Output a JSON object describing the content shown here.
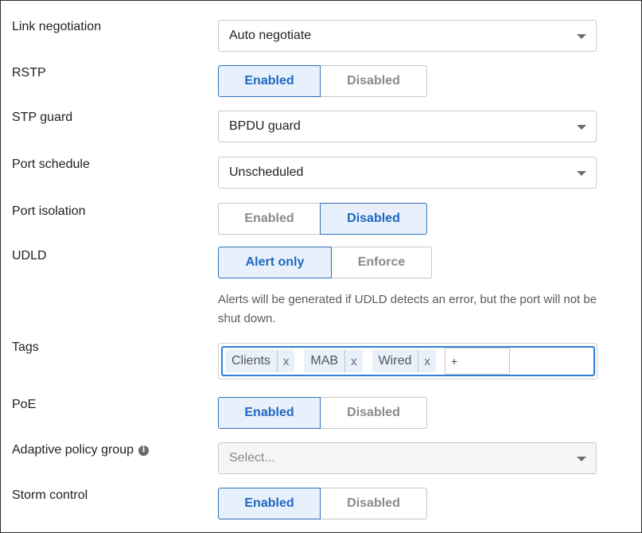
{
  "link_negotiation": {
    "label": "Link negotiation",
    "value": "Auto negotiate"
  },
  "rstp": {
    "label": "RSTP",
    "options": [
      "Enabled",
      "Disabled"
    ],
    "selected": "Enabled"
  },
  "stp_guard": {
    "label": "STP guard",
    "value": "BPDU guard"
  },
  "port_schedule": {
    "label": "Port schedule",
    "value": "Unscheduled"
  },
  "port_isolation": {
    "label": "Port isolation",
    "options": [
      "Enabled",
      "Disabled"
    ],
    "selected": "Disabled"
  },
  "udld": {
    "label": "UDLD",
    "options": [
      "Alert only",
      "Enforce"
    ],
    "selected": "Alert only",
    "helper_line1": "Alerts will be generated if UDLD detects an error, but the port will not be",
    "helper_line2": "shut down."
  },
  "tags": {
    "label": "Tags",
    "items": [
      "Clients",
      "MAB",
      "Wired"
    ],
    "remove_glyph": "x",
    "add_placeholder": "+"
  },
  "poe": {
    "label": "PoE",
    "options": [
      "Enabled",
      "Disabled"
    ],
    "selected": "Enabled"
  },
  "adaptive_policy_group": {
    "label": "Adaptive policy group",
    "info_icon": "i",
    "placeholder": "Select..."
  },
  "storm_control": {
    "label": "Storm control",
    "options": [
      "Enabled",
      "Disabled"
    ],
    "selected": "Enabled"
  },
  "colors": {
    "accent": "#1f67c2",
    "active_bg": "#e8f1fb",
    "focus_border": "#2f7fd6"
  }
}
